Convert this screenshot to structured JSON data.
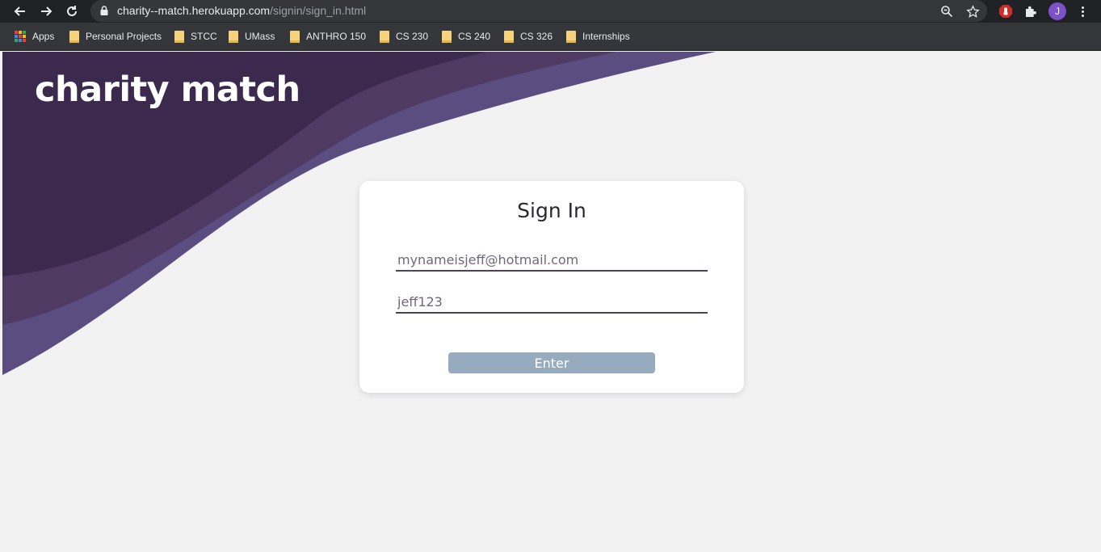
{
  "browser": {
    "url_host": "charity--match.herokuapp.com",
    "url_path": "/signin/sign_in.html",
    "profile_initial": "J",
    "icons": [
      "back-icon",
      "forward-icon",
      "reload-icon",
      "lock-icon",
      "zoom-icon",
      "star-icon",
      "adblock-icon",
      "extensions-icon",
      "menu-icon"
    ]
  },
  "bookmarks": [
    {
      "label": "Apps",
      "icon": "apps-grid-icon"
    },
    {
      "label": "Personal Projects",
      "icon": "folder-icon"
    },
    {
      "label": "STCC",
      "icon": "folder-icon"
    },
    {
      "label": "UMass",
      "icon": "folder-icon"
    },
    {
      "label": "ANTHRO 150",
      "icon": "folder-icon"
    },
    {
      "label": "CS 230",
      "icon": "folder-icon"
    },
    {
      "label": "CS 240",
      "icon": "folder-icon"
    },
    {
      "label": "CS 326",
      "icon": "folder-icon"
    },
    {
      "label": "Internships",
      "icon": "folder-icon"
    }
  ],
  "site": {
    "brand": "charity match",
    "colors": {
      "wave_dark": "#3b2a4d",
      "wave_mid": "#4f3a64",
      "wave_light": "#5b4d80",
      "background": "#f2f2f3",
      "button": "#96abbd"
    }
  },
  "signin": {
    "title": "Sign In",
    "email_value": "mynameisjeff@hotmail.com",
    "password_value": "jeff123",
    "enter_label": "Enter"
  }
}
